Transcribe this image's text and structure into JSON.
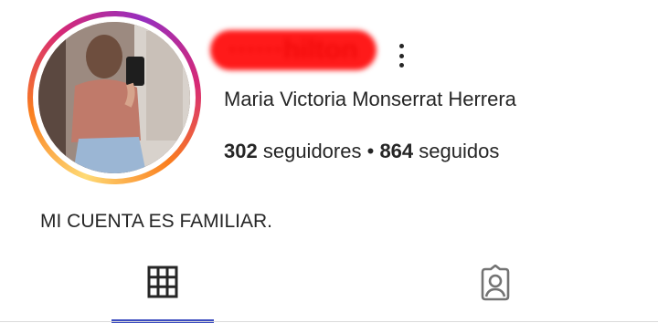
{
  "profile": {
    "username": "······hilton",
    "full_name": "Maria Victoria Monserrat Herrera",
    "followers_count": "302",
    "followers_label": "seguidores",
    "separator": "•",
    "following_count": "864",
    "following_label": "seguidos",
    "bio": "MI CUENTA ES FAMILIAR."
  },
  "icons": {
    "more": "more-vertical-icon",
    "grid_tab": "grid-icon",
    "tagged_tab": "tagged-person-icon"
  },
  "tabs": {
    "active": "grid"
  },
  "colors": {
    "accent_tab": "#3b4cc0",
    "redaction": "#ff1a1a",
    "text": "#262626"
  }
}
